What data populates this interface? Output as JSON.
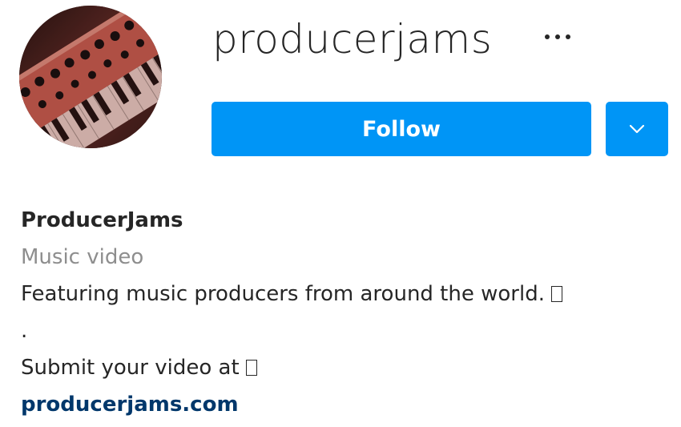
{
  "profile": {
    "username": "producerjams",
    "avatar_icon": "synthesizer-keyboard-photo",
    "more_options_icon": "ellipsis-icon"
  },
  "actions": {
    "follow_label": "Follow",
    "dropdown_icon": "chevron-down-icon",
    "accent_color": "#0095f6"
  },
  "bio": {
    "display_name": "ProducerJams",
    "category": "Music video",
    "description": "Featuring music producers from around the world.",
    "separator": ".",
    "submit_text": "Submit your video at",
    "website": "producerjams.com"
  }
}
